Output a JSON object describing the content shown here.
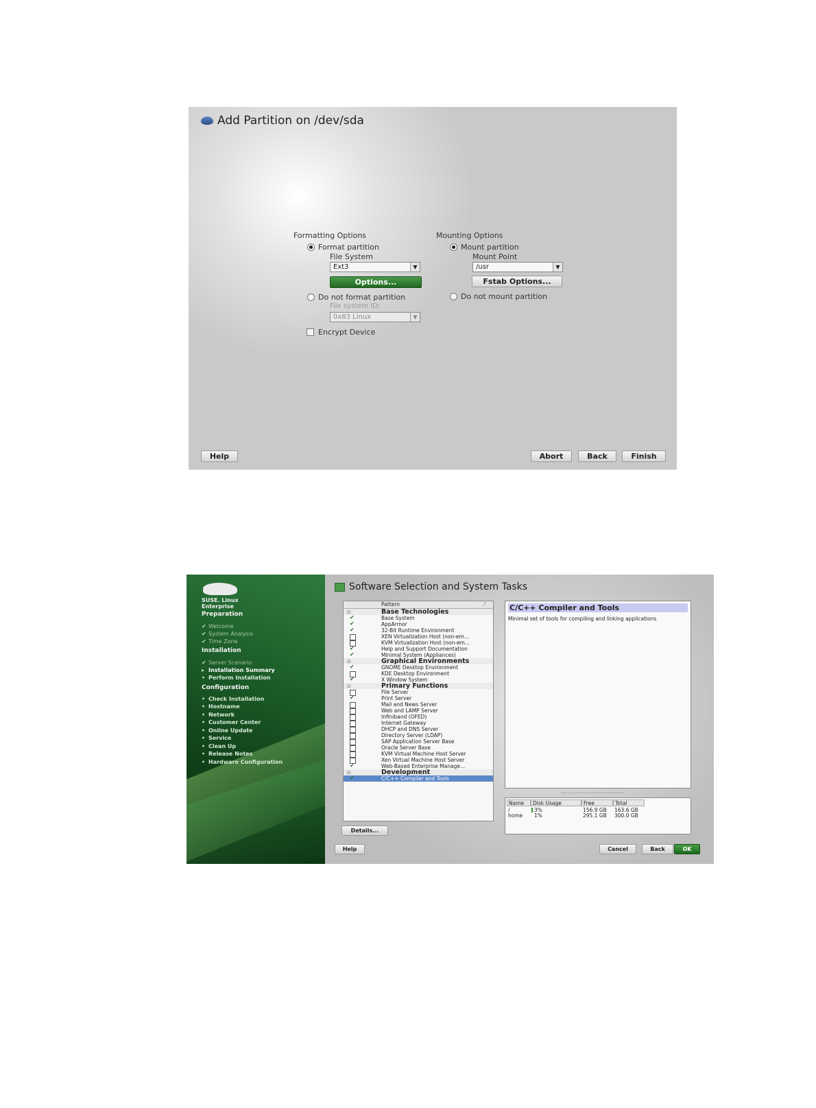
{
  "partition_dialog": {
    "title": "Add Partition on /dev/sda",
    "formatting": {
      "heading": "Formatting Options",
      "format_label": "Format partition",
      "filesystem_label": "File System",
      "filesystem_value": "Ext3",
      "options_button": "Options...",
      "no_format_label": "Do not format partition",
      "fsid_label": "File system ID:",
      "fsid_value": "0x83 Linux",
      "encrypt_label": "Encrypt Device"
    },
    "mounting": {
      "heading": "Mounting Options",
      "mount_label": "Mount partition",
      "mountpoint_label": "Mount Point",
      "mountpoint_value": "/usr",
      "fstab_button": "Fstab Options...",
      "no_mount_label": "Do not mount partition"
    },
    "buttons": {
      "help": "Help",
      "abort": "Abort",
      "back": "Back",
      "finish": "Finish"
    }
  },
  "software_dialog": {
    "title": "Software Selection and System Tasks",
    "brand": [
      "SUSE. Linux",
      "Enterprise"
    ],
    "sidebar": {
      "preparation": "Preparation",
      "prep_steps": [
        "Welcome",
        "System Analysis",
        "Time Zone"
      ],
      "installation": "Installation",
      "inst_steps": [
        "Server Scenario",
        "Installation Summary",
        "Perform Installation"
      ],
      "configuration": "Configuration",
      "config_steps": [
        "Check Installation",
        "Hostname",
        "Network",
        "Customer Center",
        "Online Update",
        "Service",
        "Clean Up",
        "Release Notes",
        "Hardware Configuration"
      ]
    },
    "pattern_header": "Pattern",
    "patterns": [
      {
        "t": "Base Technologies",
        "g": true
      },
      {
        "t": "Base System",
        "s": "on"
      },
      {
        "t": "AppArmor",
        "s": "on"
      },
      {
        "t": "32-Bit Runtime Environment",
        "s": "on"
      },
      {
        "t": "XEN Virtualization Host (non-em...",
        "s": "off"
      },
      {
        "t": "KVM Virtualization Host (non-em...",
        "s": "off"
      },
      {
        "t": "Help and Support Documentation",
        "s": "on"
      },
      {
        "t": "Minimal System (Appliances)",
        "s": "on"
      },
      {
        "t": "Graphical Environments",
        "g": true
      },
      {
        "t": "GNOME Desktop Environment",
        "s": "on"
      },
      {
        "t": "KDE Desktop Environment",
        "s": "off"
      },
      {
        "t": "X Window System",
        "s": "on"
      },
      {
        "t": "Primary Functions",
        "g": true
      },
      {
        "t": "File Server",
        "s": "off"
      },
      {
        "t": "Print Server",
        "s": "on"
      },
      {
        "t": "Mail and News Server",
        "s": "off"
      },
      {
        "t": "Web and LAMP Server",
        "s": "off"
      },
      {
        "t": "Infiniband (OFED)",
        "s": "off"
      },
      {
        "t": "Internet Gateway",
        "s": "off"
      },
      {
        "t": "DHCP and DNS Server",
        "s": "off"
      },
      {
        "t": "Directory Server (LDAP)",
        "s": "off"
      },
      {
        "t": "SAP Application Server Base",
        "s": "off"
      },
      {
        "t": "Oracle Server Base",
        "s": "off"
      },
      {
        "t": "KVM Virtual Machine Host Server",
        "s": "off"
      },
      {
        "t": "Xen Virtual Machine Host Server",
        "s": "off"
      },
      {
        "t": "Web-Based Enterprise Manage...",
        "s": "on"
      },
      {
        "t": "Development",
        "g": true
      },
      {
        "t": "C/C++ Compiler and Tools",
        "s": "on",
        "sel": true
      }
    ],
    "description": {
      "title": "C/C++ Compiler and Tools",
      "text": "Minimal set of tools for compiling and linking applications"
    },
    "disk": {
      "headers": [
        "Name",
        "Disk Usage",
        "Free",
        "Total"
      ],
      "rows": [
        {
          "name": "/",
          "usage": "3%",
          "usage_value": 3,
          "free": "156.9 GB",
          "total": "163.6 GB"
        },
        {
          "name": "home",
          "usage": "1%",
          "usage_value": 1,
          "free": "295.1 GB",
          "total": "300.0 GB"
        }
      ]
    },
    "buttons": {
      "details": "Details...",
      "help": "Help",
      "cancel": "Cancel",
      "back": "Back",
      "ok": "OK"
    }
  }
}
